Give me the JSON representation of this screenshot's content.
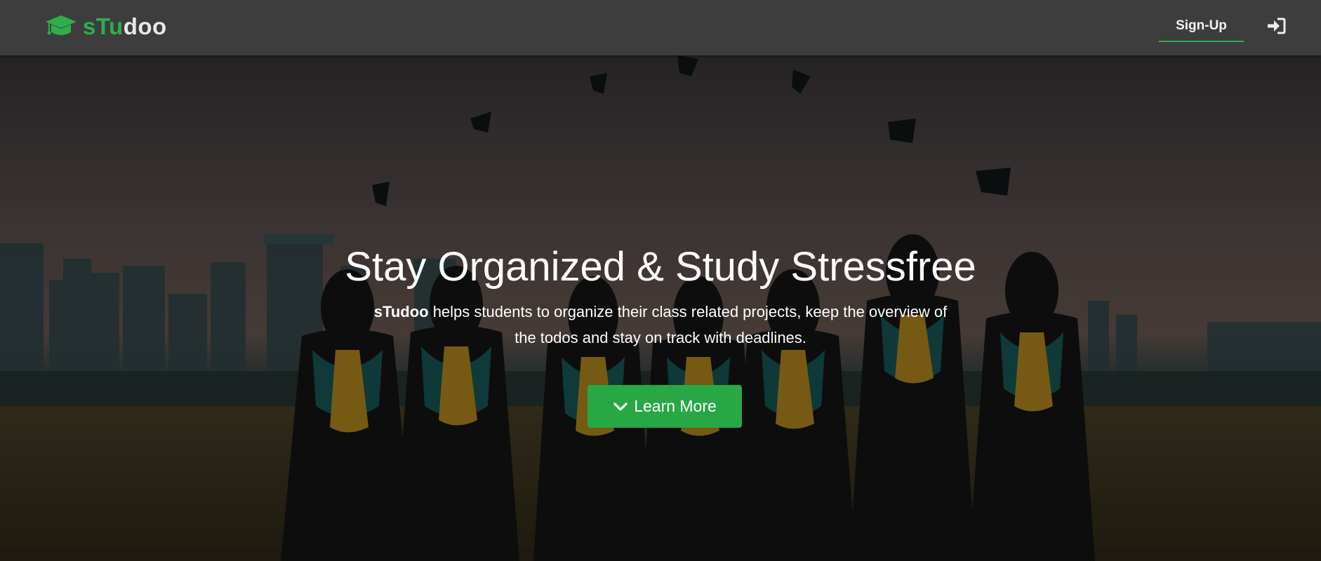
{
  "brand": {
    "name_part1": "sTu",
    "name_part2": "doo",
    "icon": "graduation-cap-icon"
  },
  "nav": {
    "signup_label": "Sign-Up",
    "login_icon": "sign-in-icon"
  },
  "hero": {
    "title": "Stay Organized & Study Stressfree",
    "subtitle_brand": "sTudoo",
    "subtitle_text": " helps students to organize their class related projects, keep the overview of the todos and stay on track with deadlines.",
    "cta_label": "Learn More",
    "cta_icon": "chevron-down-icon"
  },
  "colors": {
    "accent": "#28a745",
    "navbar": "#3d3d3d"
  }
}
